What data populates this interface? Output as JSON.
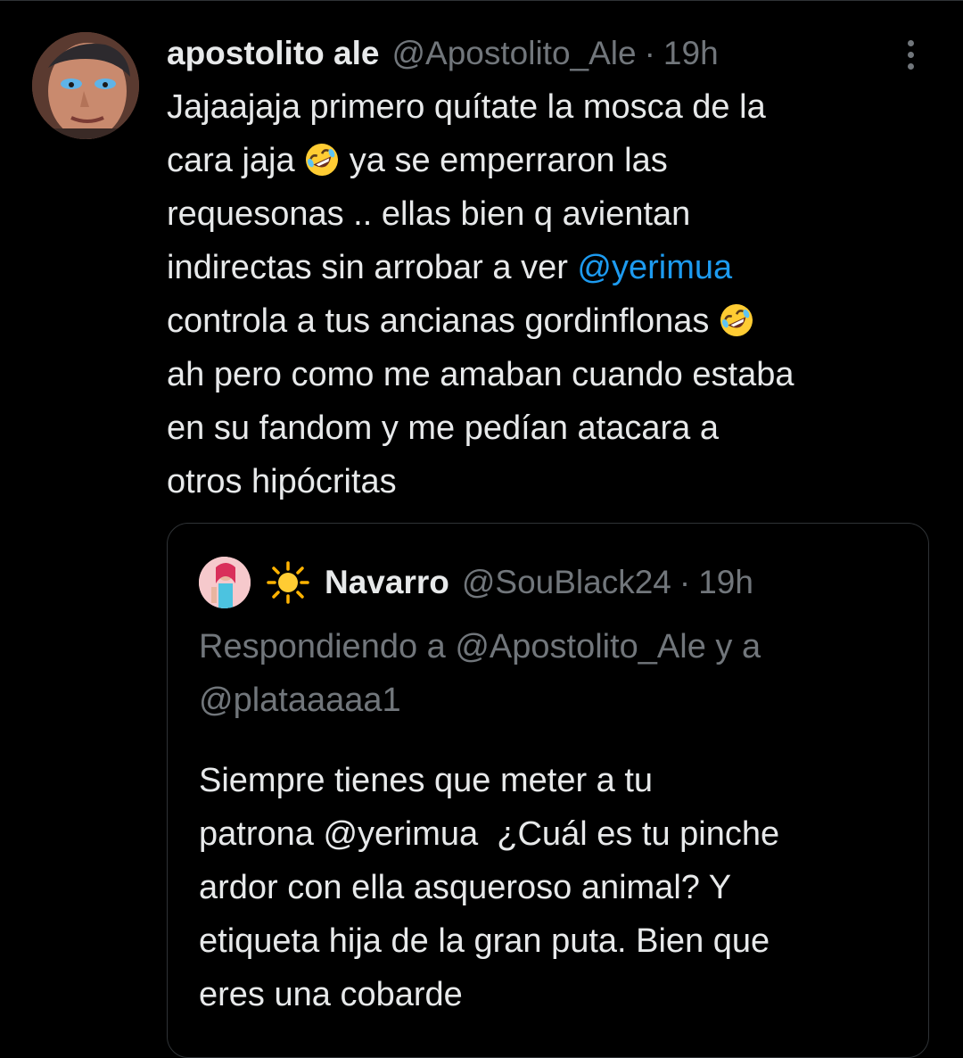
{
  "tweet": {
    "author": {
      "display_name": "apostolito ale",
      "handle": "@Apostolito_Ale",
      "separator": "·",
      "time": "19h"
    },
    "body_lines": [
      {
        "text": "Jajaajaja primero quítate la mosca de la"
      },
      {
        "pre": "cara jaja ",
        "emoji": "rolling-on-floor-laughing-emoji",
        "post": " ya se emperraron las"
      },
      {
        "text": "requesonas .. ellas bien q avientan"
      },
      {
        "pre": "indirectas sin arrobar a ver ",
        "mention": "@yerimua"
      },
      {
        "pre": "controla a tus ancianas gordinflonas ",
        "emoji": "rolling-on-floor-laughing-emoji"
      },
      {
        "text": "ah pero como me amaban cuando estaba"
      },
      {
        "text": "en su fandom y me pedían atacara a"
      },
      {
        "text": "otros hipócritas"
      }
    ],
    "more_icon": "more-horizontal-icon"
  },
  "quote": {
    "author": {
      "sun_emoji": "sun-emoji",
      "display_name": "Navarro",
      "handle": "@SouBlack24",
      "separator": "·",
      "time": "19h"
    },
    "reply_context_lines": [
      "Respondiendo a @Apostolito_Ale y a",
      "@plataaaaa1"
    ],
    "body_lines": [
      "Siempre tienes que meter a tu",
      "patrona @yerimua  ¿Cuál es tu pinche",
      "ardor con ella asqueroso animal? Y",
      "etiqueta hija de la gran puta. Bien que",
      "eres una cobarde"
    ]
  },
  "colors": {
    "background": "#000000",
    "text_primary": "#e7e9ea",
    "text_secondary": "#71767b",
    "link": "#1d9bf0",
    "border": "#2f3336"
  }
}
